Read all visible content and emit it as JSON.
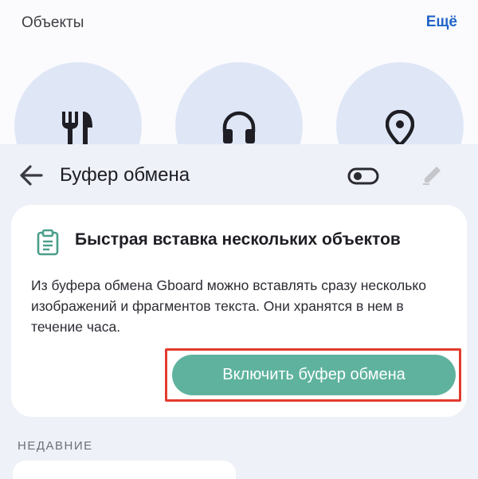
{
  "objects_section": {
    "title": "Объекты",
    "more_label": "Ещё",
    "items": [
      {
        "icon": "restaurant-icon"
      },
      {
        "icon": "headphones-icon"
      },
      {
        "icon": "location-pin-icon"
      }
    ]
  },
  "clipboard_panel": {
    "title": "Буфер обмена",
    "header_icons": [
      "back-arrow-icon",
      "toggle-icon",
      "pencil-icon"
    ]
  },
  "promo_card": {
    "icon": "clipboard-icon",
    "title": "Быстрая вставка нескольких объектов",
    "description": "Из буфера обмена Gboard можно вставлять сразу несколько изображений и фрагментов текста. Они хранятся в нем в течение часа.",
    "button_label": "Включить буфер обмена"
  },
  "recent": {
    "label": "НЕДАВНИЕ"
  },
  "colors": {
    "accent_link": "#1f64c8",
    "button_fill": "#5fb39e",
    "highlight_border": "#e23b2e",
    "circle_fill": "#dfe7f7",
    "panel_bg": "#eef1f7"
  }
}
